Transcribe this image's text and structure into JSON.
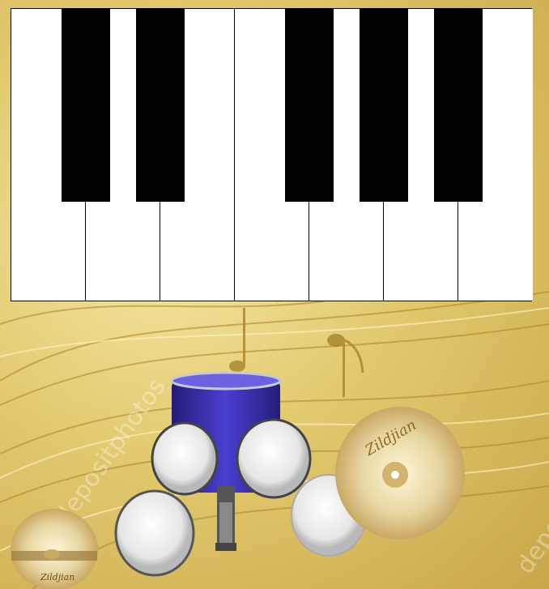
{
  "keyboard": {
    "white_keys": [
      "C",
      "D",
      "E",
      "F",
      "G",
      "A",
      "B"
    ],
    "black_keys": [
      "C#",
      "D#",
      "F#",
      "G#",
      "A#"
    ]
  },
  "drum_kit": {
    "pieces": [
      "bass-drum",
      "tom-left",
      "tom-right",
      "floor-tom",
      "snare",
      "crash-cymbal",
      "hihat-cymbal",
      "hihat-pedal"
    ]
  },
  "cymbal_brand": "Zildjian",
  "watermark": "depositphotos",
  "colors": {
    "key_black": "#000000",
    "key_white": "#ffffff",
    "drum_shell": "#3b2fa8",
    "gold_bg": "#e2c96e"
  }
}
